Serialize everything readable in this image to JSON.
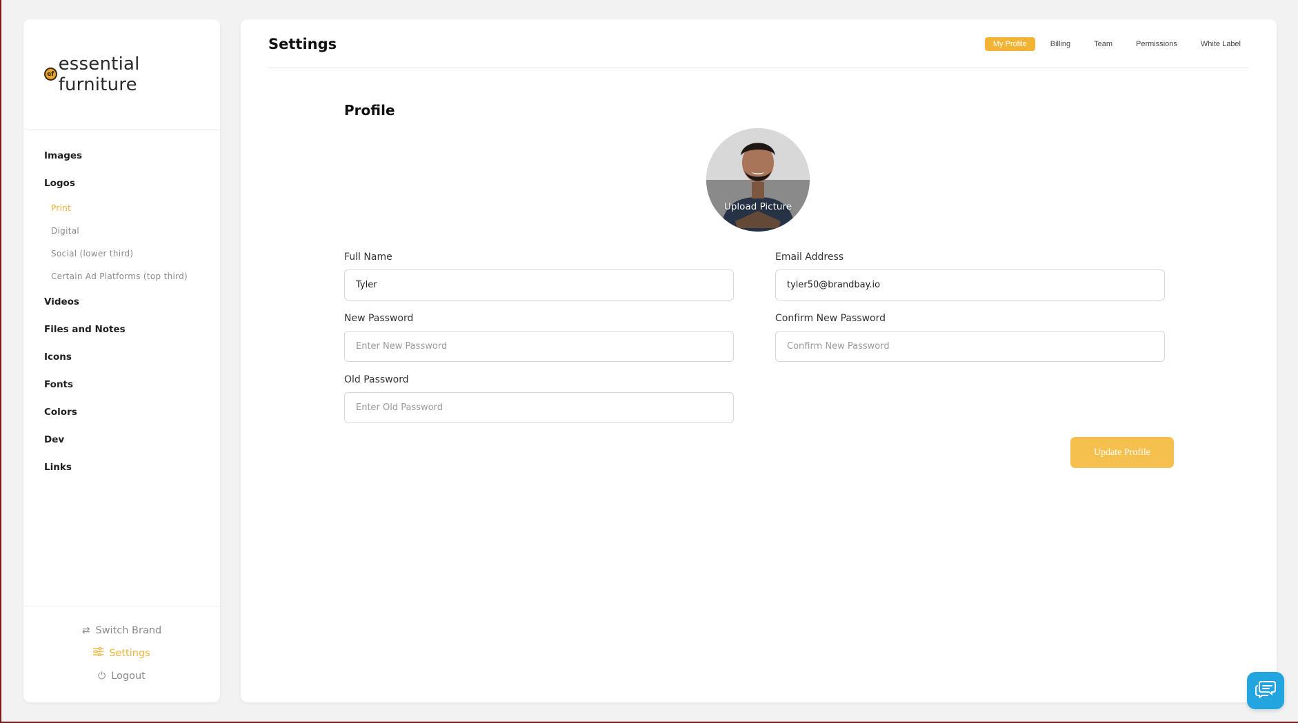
{
  "brand": {
    "logo_mark": "ef",
    "name": "essential furniture"
  },
  "sidebar": {
    "items": [
      {
        "label": "Images"
      },
      {
        "label": "Logos",
        "children": [
          {
            "label": "Print",
            "active": true
          },
          {
            "label": "Digital"
          },
          {
            "label": "Social (lower third)"
          },
          {
            "label": "Certain Ad Platforms (top third)"
          }
        ]
      },
      {
        "label": "Videos"
      },
      {
        "label": "Files and Notes"
      },
      {
        "label": "Icons"
      },
      {
        "label": "Fonts"
      },
      {
        "label": "Colors"
      },
      {
        "label": "Dev"
      },
      {
        "label": "Links"
      }
    ],
    "footer": [
      {
        "label": "Switch Brand",
        "icon": "switch-icon"
      },
      {
        "label": "Settings",
        "icon": "sliders-icon",
        "active": true
      },
      {
        "label": "Logout",
        "icon": "power-icon"
      }
    ]
  },
  "header": {
    "title": "Settings",
    "tabs": [
      {
        "label": "My Profile",
        "active": true
      },
      {
        "label": "Billing"
      },
      {
        "label": "Team"
      },
      {
        "label": "Permissions"
      },
      {
        "label": "White Label"
      }
    ]
  },
  "profile": {
    "title": "Profile",
    "avatar_label": "Upload Picture",
    "full_name": {
      "label": "Full Name",
      "value": "Tyler"
    },
    "email": {
      "label": "Email Address",
      "value": "tyler50@brandbay.io"
    },
    "new_password": {
      "label": "New Password",
      "placeholder": "Enter New Password"
    },
    "confirm_password": {
      "label": "Confirm New Password",
      "placeholder": "Confirm New Password"
    },
    "old_password": {
      "label": "Old Password",
      "placeholder": "Enter Old Password"
    },
    "submit_label": "Update Profile"
  },
  "colors": {
    "accent": "#f3b435",
    "chat": "#23a6e0"
  }
}
